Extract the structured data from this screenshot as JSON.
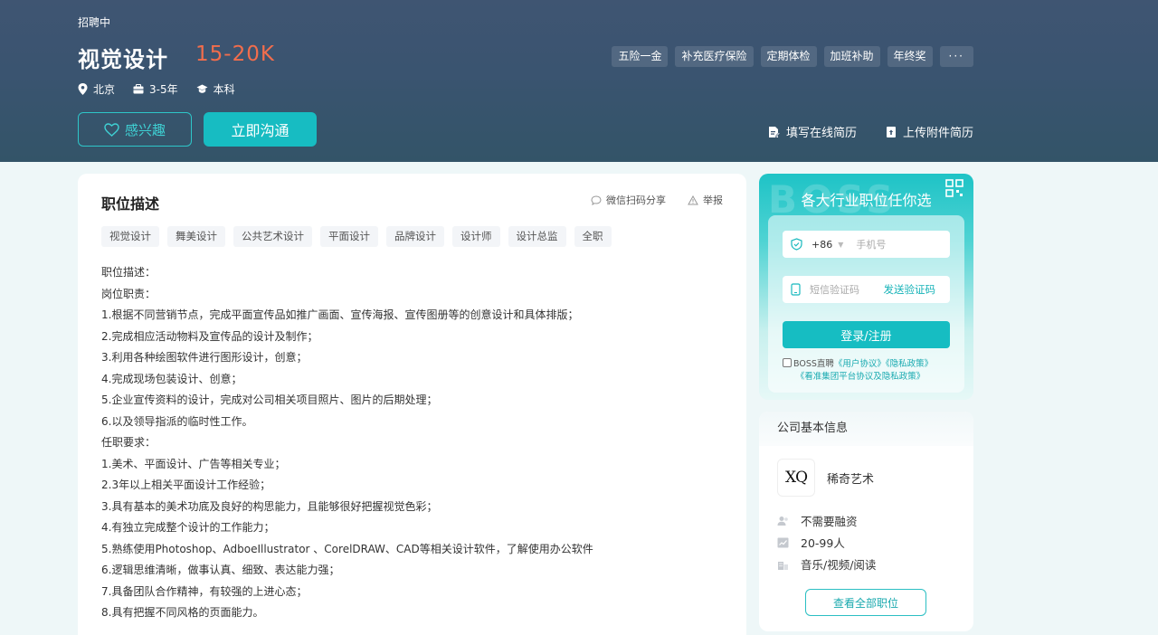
{
  "header": {
    "status": "招聘中",
    "job_title": "视觉设计",
    "salary": "15-20K",
    "location": "北京",
    "experience": "3-5年",
    "education": "本科",
    "benefits": [
      "五险一金",
      "补充医疗保险",
      "定期体检",
      "加班补助",
      "年终奖"
    ],
    "benefits_more": "···",
    "interest_label": "感兴趣",
    "chat_label": "立即沟通",
    "online_resume_label": "填写在线简历",
    "upload_resume_label": "上传附件简历"
  },
  "description": {
    "title": "职位描述",
    "share_label": "微信扫码分享",
    "report_label": "举报",
    "tags": [
      "视觉设计",
      "舞美设计",
      "公共艺术设计",
      "平面设计",
      "品牌设计",
      "设计师",
      "设计总监",
      "全职"
    ],
    "lines": [
      "职位描述：",
      "岗位职责：",
      "1.根据不同营销节点，完成平面宣传品如推广画面、宣传海报、宣传图册等的创意设计和具体排版；",
      "2.完成相应活动物料及宣传品的设计及制作；",
      "3.利用各种绘图软件进行图形设计，创意；",
      "4.完成现场包装设计、创意；",
      "5.企业宣传资料的设计，完成对公司相关项目照片、图片的后期处理；",
      "6.以及领导指派的临时性工作。",
      "任职要求：",
      "1.美术、平面设计、广告等相关专业；",
      "2.3年以上相关平面设计工作经验；",
      "3.具有基本的美术功底及良好的构思能力，且能够很好把握视觉色彩；",
      "4.有独立完成整个设计的工作能力；",
      "5.熟练使用Photoshop、AdboeIllustrator 、CorelDRAW、CAD等相关设计软件，了解使用办公软件",
      "6.逻辑思维清晰，做事认真、细致、表达能力强；",
      "7.具备团队合作精神，有较强的上进心态；",
      "8.具有把握不同风格的页面能力。"
    ]
  },
  "login": {
    "bg_word": "BOSS",
    "title": "各大行业职位任你选",
    "country_code": "+86",
    "phone_placeholder": "手机号",
    "code_placeholder": "短信验证码",
    "send_code_label": "发送验证码",
    "login_label": "登录/注册",
    "agree_prefix": "BOSS直聘",
    "user_agreement": "《用户协议》",
    "privacy_policy": "《隐私政策》",
    "group_agreement": "《看准集团平台协议及隐私政策》"
  },
  "company": {
    "section_title": "公司基本信息",
    "logo_text": "XQ",
    "name": "稀奇艺术",
    "financing": "不需要融资",
    "size": "20-99人",
    "industry": "音乐/视频/阅读",
    "all_jobs_label": "查看全部职位"
  },
  "colors": {
    "banner": "#3a5470",
    "accent": "#17bcc2",
    "salary": "#f26d4c"
  }
}
